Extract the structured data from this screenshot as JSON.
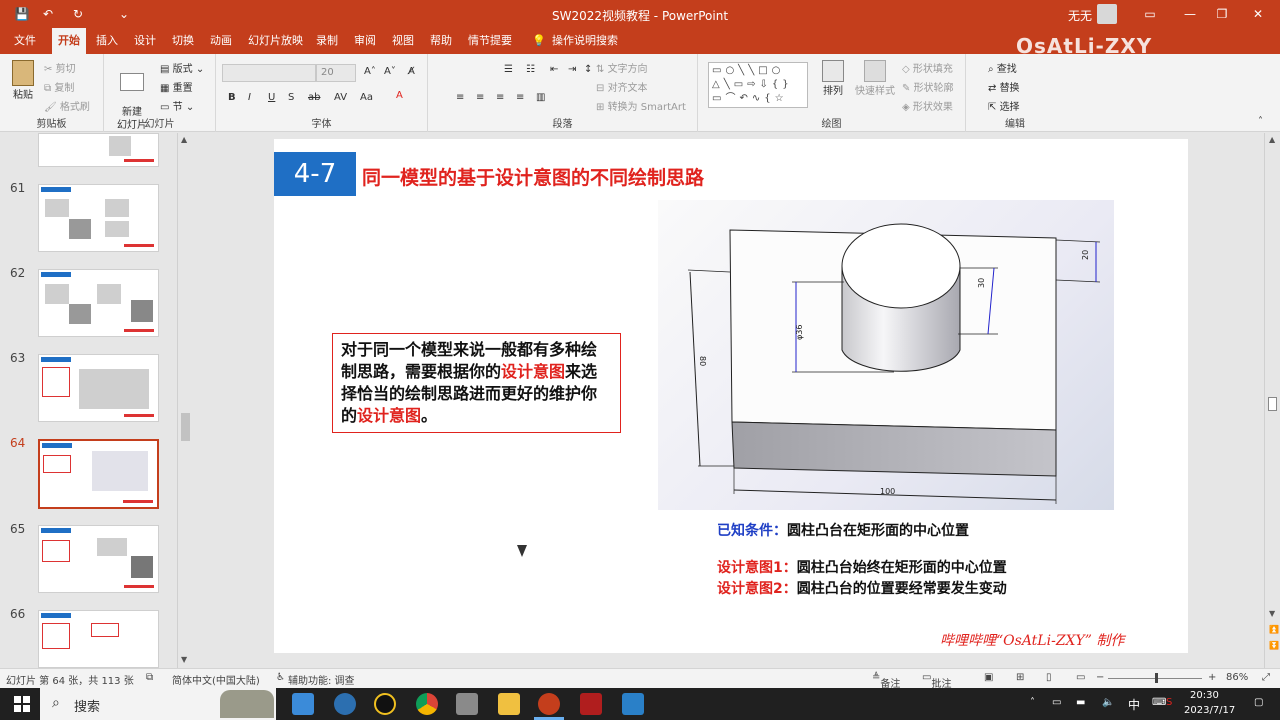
{
  "titlebar": {
    "doc_title": "SW2022视频教程 - PowerPoint",
    "user": "无无",
    "qa_save": "💾",
    "qa_undo": "↶",
    "qa_redo": "↻",
    "qa_more": "⌄"
  },
  "tabs": [
    "文件",
    "开始",
    "插入",
    "设计",
    "切换",
    "动画",
    "幻灯片放映",
    "录制",
    "审阅",
    "视图",
    "帮助",
    "情节提要"
  ],
  "tell_me": "操作说明搜索",
  "watermark": "OsAtLi-ZXY",
  "ribbon": {
    "clipboard": {
      "label": "剪贴板",
      "paste": "粘贴",
      "cut": "剪切",
      "copy": "复制",
      "format_painter": "格式刷"
    },
    "slides": {
      "label": "幻灯片",
      "new_slide": "新建\n幻灯片",
      "layout": "版式",
      "reset": "重置",
      "section": "节"
    },
    "font": {
      "label": "字体",
      "size": "20"
    },
    "paragraph": {
      "label": "段落",
      "text_direction": "文字方向",
      "align_text": "对齐文本",
      "smartart": "转换为 SmartArt"
    },
    "drawing": {
      "label": "绘图",
      "arrange": "排列",
      "quick_styles": "快速样式",
      "shape_fill": "形状填充",
      "shape_outline": "形状轮廓",
      "shape_effects": "形状效果"
    },
    "editing": {
      "label": "编辑",
      "find": "查找",
      "replace": "替换",
      "select": "选择"
    }
  },
  "thumbnails": [
    {
      "num": "61"
    },
    {
      "num": "62"
    },
    {
      "num": "63"
    },
    {
      "num": "64",
      "selected": true
    },
    {
      "num": "65"
    },
    {
      "num": "66"
    }
  ],
  "slide": {
    "badge": "4-7",
    "heading": "同一模型的基于设计意图的不同绘制思路",
    "text_parts": [
      "对于同一个模型来说一般都有多种绘制思路，需要根据你的",
      "设计意图",
      "来选择恰当的绘制思路进而更好的维护你的",
      "设计意图",
      "。"
    ],
    "dims": {
      "d20": "20",
      "d30": "30",
      "d36": "φ36",
      "d80": "80",
      "d100": "100"
    },
    "condition_label": "已知条件：",
    "condition_text": "圆柱凸台在矩形面的中心位置",
    "intent1_label": "设计意图1：",
    "intent1_text": "圆柱凸台始终在矩形面的中心位置",
    "intent2_label": "设计意图2：",
    "intent2_text": "圆柱凸台的位置要经常要发生变动",
    "signature": "哔哩哔哩“OsAtLi-ZXY” 制作"
  },
  "status": {
    "slide_info": "幻灯片 第 64 张，共 113 张",
    "language": "简体中文(中国大陆)",
    "accessibility": "辅助功能: 调查",
    "notes": "备注",
    "comments": "批注",
    "zoom": "86%"
  },
  "taskbar": {
    "search": "搜索",
    "time": "20:30",
    "date": "2023/7/17",
    "ime": "中"
  },
  "colors": {
    "accent": "#c43e1c",
    "blue": "#1f6fc5",
    "red": "#e0231e"
  }
}
